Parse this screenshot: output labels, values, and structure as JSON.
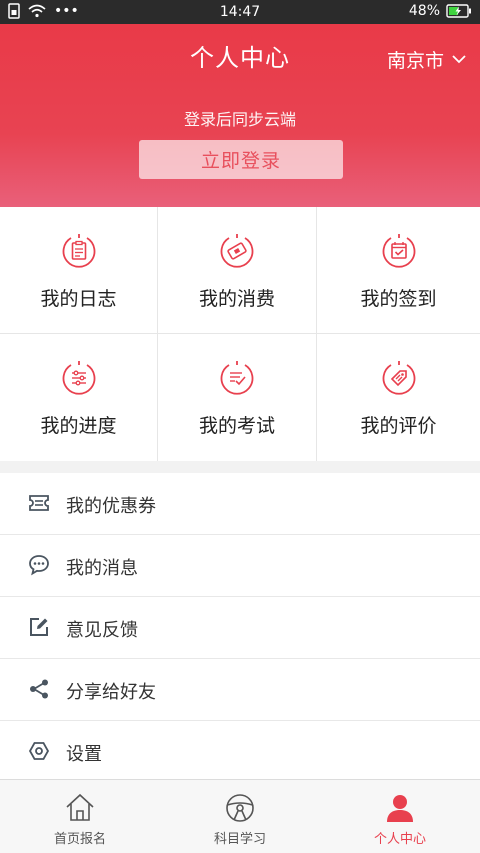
{
  "status_bar": {
    "time": "14:47",
    "battery": "48%",
    "dots": "•••"
  },
  "header": {
    "title": "个人中心",
    "city": "南京市",
    "sync_text": "登录后同步云端",
    "login_button": "立即登录"
  },
  "grid": [
    {
      "label": "我的日志",
      "icon": "clipboard-icon"
    },
    {
      "label": "我的消费",
      "icon": "ticket-icon"
    },
    {
      "label": "我的签到",
      "icon": "calendar-check-icon"
    },
    {
      "label": "我的进度",
      "icon": "sliders-icon"
    },
    {
      "label": "我的考试",
      "icon": "exam-check-icon"
    },
    {
      "label": "我的评价",
      "icon": "tag-icon"
    }
  ],
  "list": [
    {
      "label": "我的优惠券",
      "icon": "coupon-icon"
    },
    {
      "label": "我的消息",
      "icon": "chat-icon"
    },
    {
      "label": "意见反馈",
      "icon": "edit-icon"
    },
    {
      "label": "分享给好友",
      "icon": "share-icon"
    },
    {
      "label": "设置",
      "icon": "settings-icon"
    }
  ],
  "tabs": [
    {
      "label": "首页报名",
      "icon": "home-icon"
    },
    {
      "label": "科目学习",
      "icon": "steering-wheel-icon"
    },
    {
      "label": "个人中心",
      "icon": "person-icon"
    }
  ],
  "colors": {
    "accent": "#e8404e",
    "header_top": "#e93a48",
    "header_bottom": "#e9607a",
    "icon_gray": "#4a5560"
  }
}
